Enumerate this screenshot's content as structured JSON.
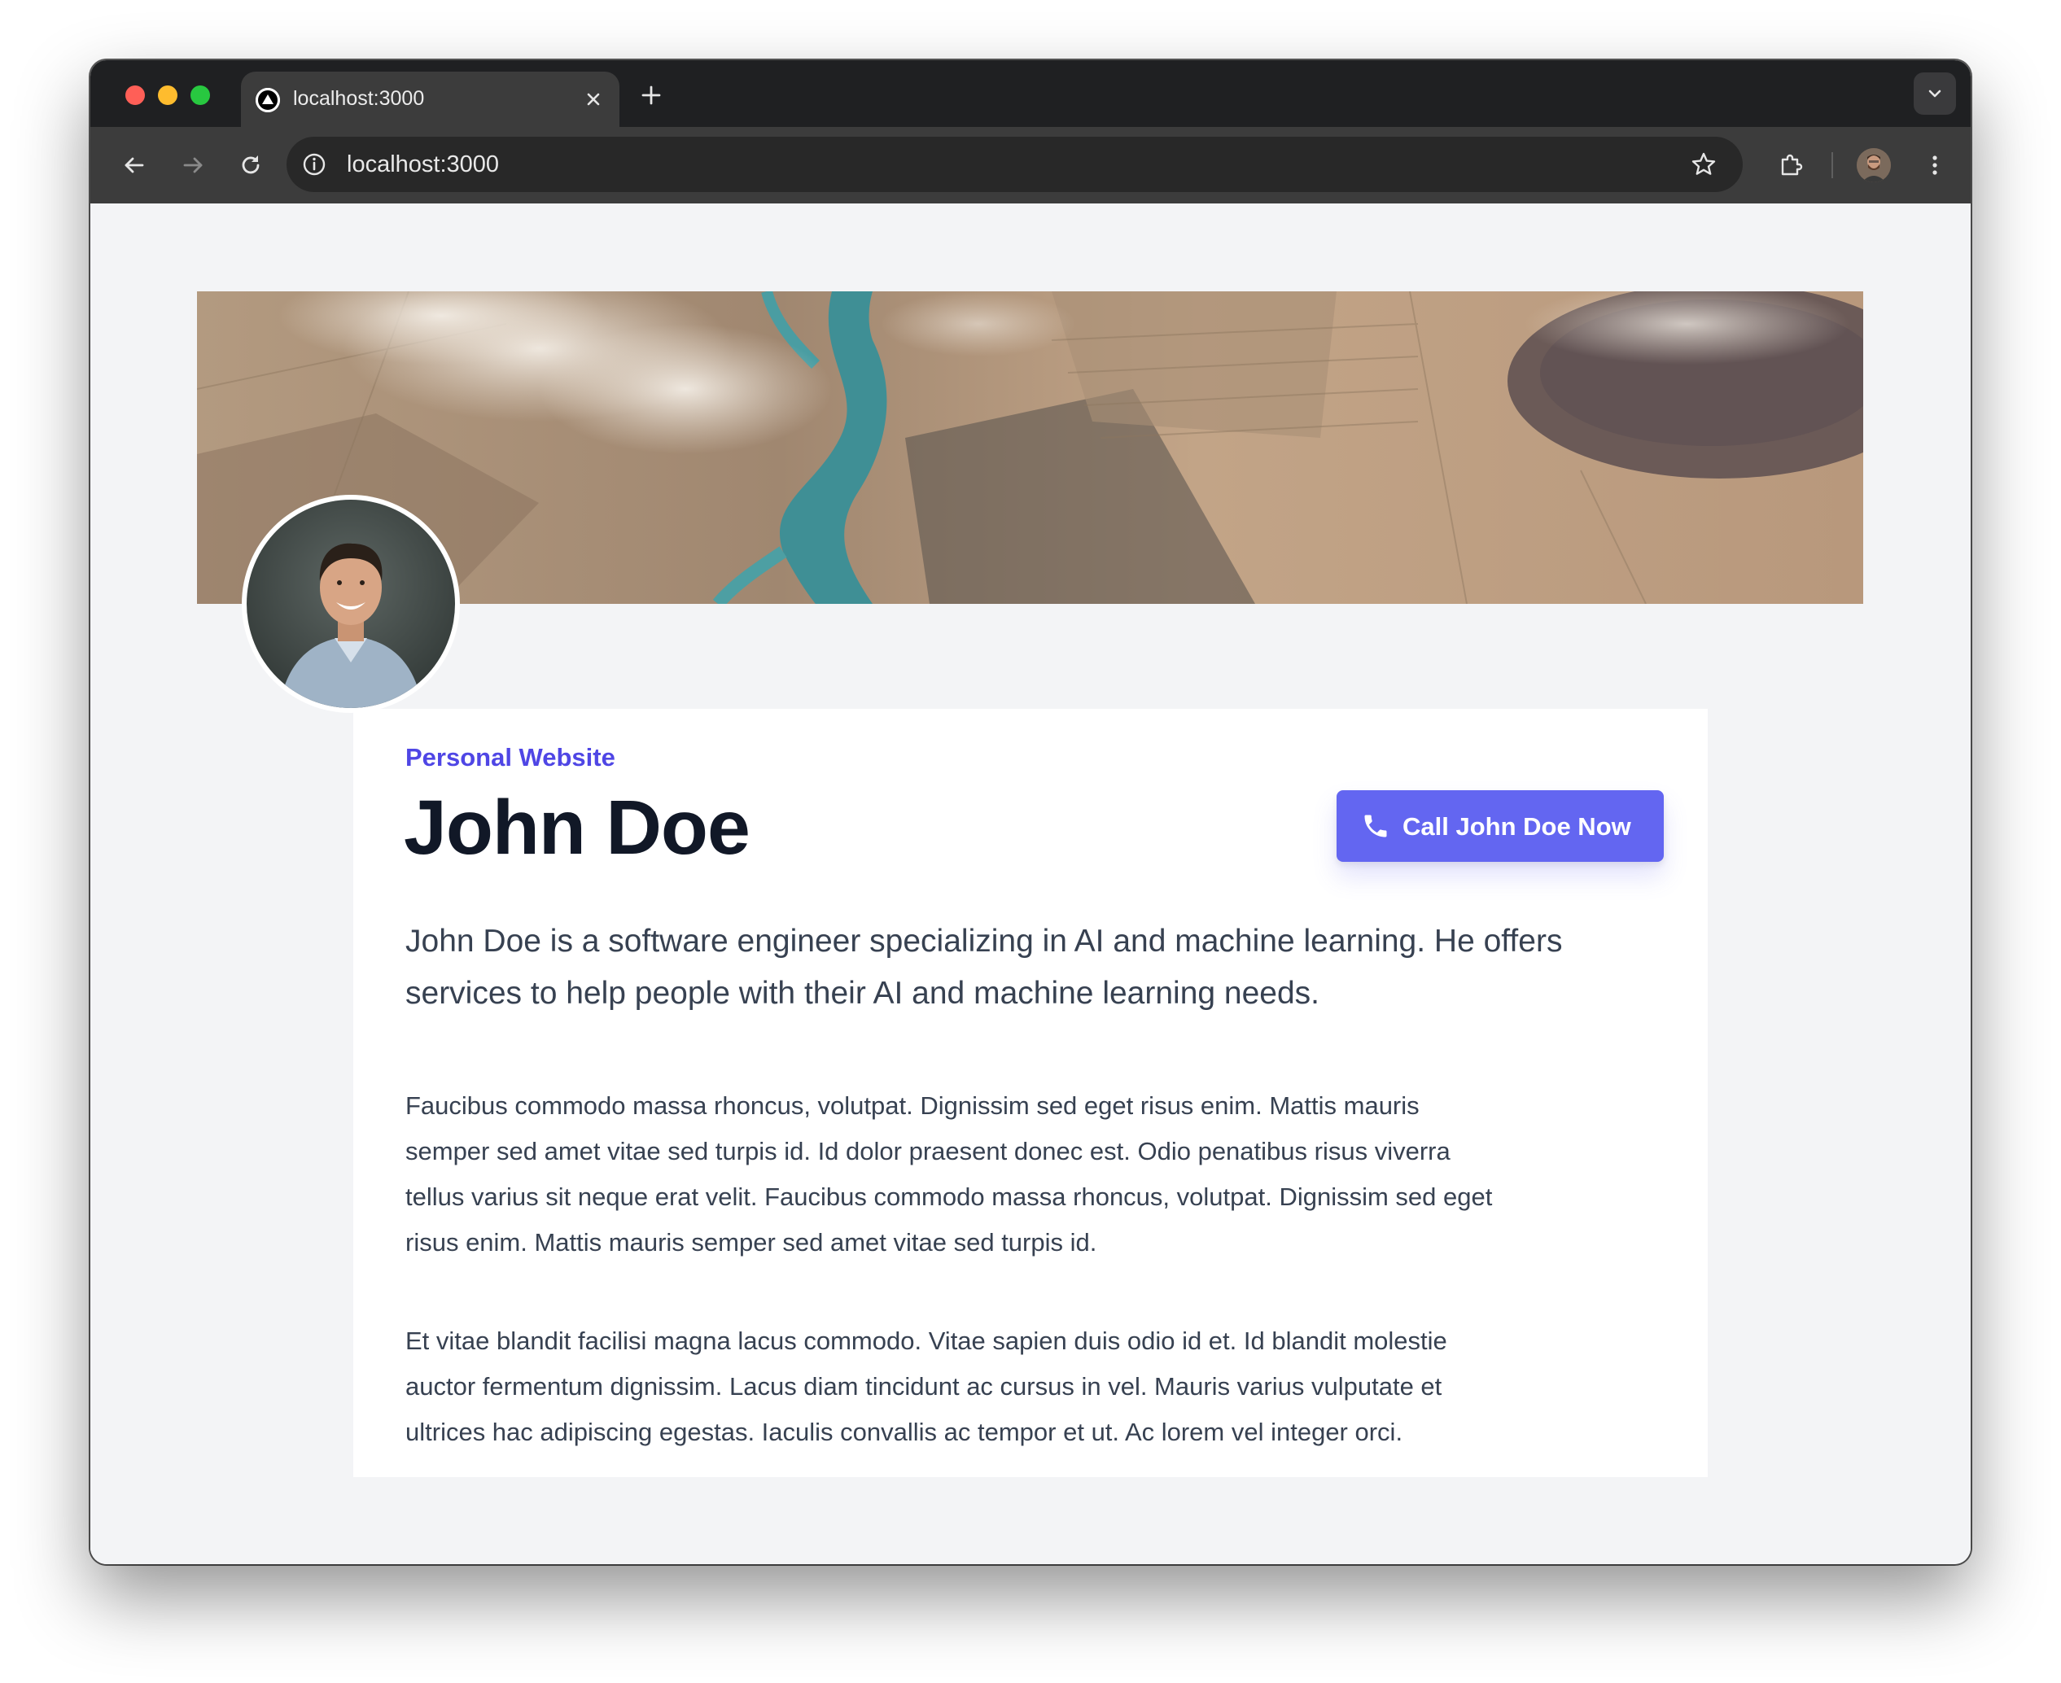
{
  "browser": {
    "tab_title": "localhost:3000",
    "url": "localhost:3000",
    "icons": {
      "favicon": "triangle-favicon-icon",
      "tab_close": "close-icon",
      "new_tab": "plus-icon",
      "tab_search": "chevron-down-icon",
      "back": "arrow-left-icon",
      "forward": "arrow-right-icon",
      "reload": "reload-icon",
      "site_info": "info-icon",
      "bookmark": "star-icon",
      "extensions": "puzzle-icon",
      "menu": "kebab-menu-icon"
    }
  },
  "profile": {
    "eyebrow": "Personal Website",
    "name": "John Doe",
    "cta_label": "Call John Doe Now",
    "cta_icon": "phone-icon",
    "lead": "John Doe is a software engineer specializing in AI and machine learning. He offers services to help people with their AI and machine learning needs.",
    "paragraphs": [
      "Faucibus commodo massa rhoncus, volutpat. Dignissim sed eget risus enim. Mattis mauris semper sed amet vitae sed turpis id. Id dolor praesent donec est. Odio penatibus risus viverra tellus varius sit neque erat velit. Faucibus commodo massa rhoncus, volutpat. Dignissim sed eget risus enim. Mattis mauris semper sed amet vitae sed turpis id.",
      "Et vitae blandit facilisi magna lacus commodo. Vitae sapien duis odio id et. Id blandit molestie auctor fermentum dignissim. Lacus diam tincidunt ac cursus in vel. Mauris varius vulputate et ultrices hac adipiscing egestas. Iaculis convallis ac tempor et ut. Ac lorem vel integer orci."
    ]
  },
  "colors": {
    "accent": "#6366f1",
    "eyebrow": "#4f46e5",
    "heading": "#111827",
    "body_text": "#374151",
    "page_bg": "#f3f4f6"
  }
}
